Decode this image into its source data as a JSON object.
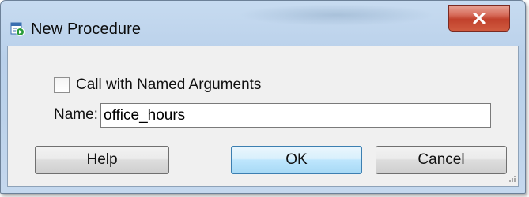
{
  "window": {
    "title": "New Procedure",
    "title_icon": "new-procedure-icon",
    "close_icon": "close-icon"
  },
  "form": {
    "checkbox_label": "Call with Named Arguments",
    "checkbox_checked": false,
    "name_label": "Name:",
    "name_value": "office_hours"
  },
  "buttons": {
    "help_prefix": "",
    "help_mnemonic": "H",
    "help_rest": "elp",
    "ok_label": "OK",
    "cancel_label": "Cancel"
  },
  "colors": {
    "frame": "#bcd2ea",
    "close_button": "#c1412c",
    "client": "#f0f0f0",
    "default_button_border": "#3c7fb1"
  }
}
